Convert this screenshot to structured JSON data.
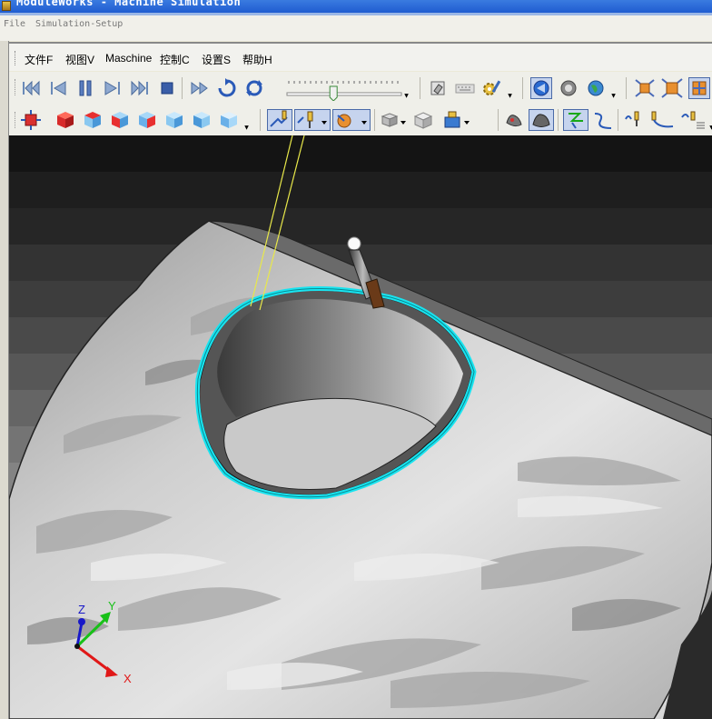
{
  "window": {
    "title": "ModuleWorks - Machine Simulation"
  },
  "app_menu": [
    "File",
    "Simulation-Setup"
  ],
  "menu": [
    {
      "label": "文件F"
    },
    {
      "label": "视图V"
    },
    {
      "label": "Maschine"
    },
    {
      "label": "控制C"
    },
    {
      "label": "设置S"
    },
    {
      "label": "帮助H"
    }
  ],
  "toolbar1": {
    "playback": [
      "skip-to-start-icon",
      "step-back-icon",
      "pause-icon",
      "step-forward-icon",
      "skip-to-end-icon",
      "stop-icon"
    ],
    "speed_slider_value": 0.4
  },
  "axes": {
    "x": "X",
    "y": "Y",
    "z": "Z"
  },
  "colors": {
    "toolpath": "#19e4f0",
    "tool_lines": "#e8e84a",
    "x_axis": "#e01818",
    "y_axis": "#18c018",
    "z_axis": "#1818c8"
  }
}
